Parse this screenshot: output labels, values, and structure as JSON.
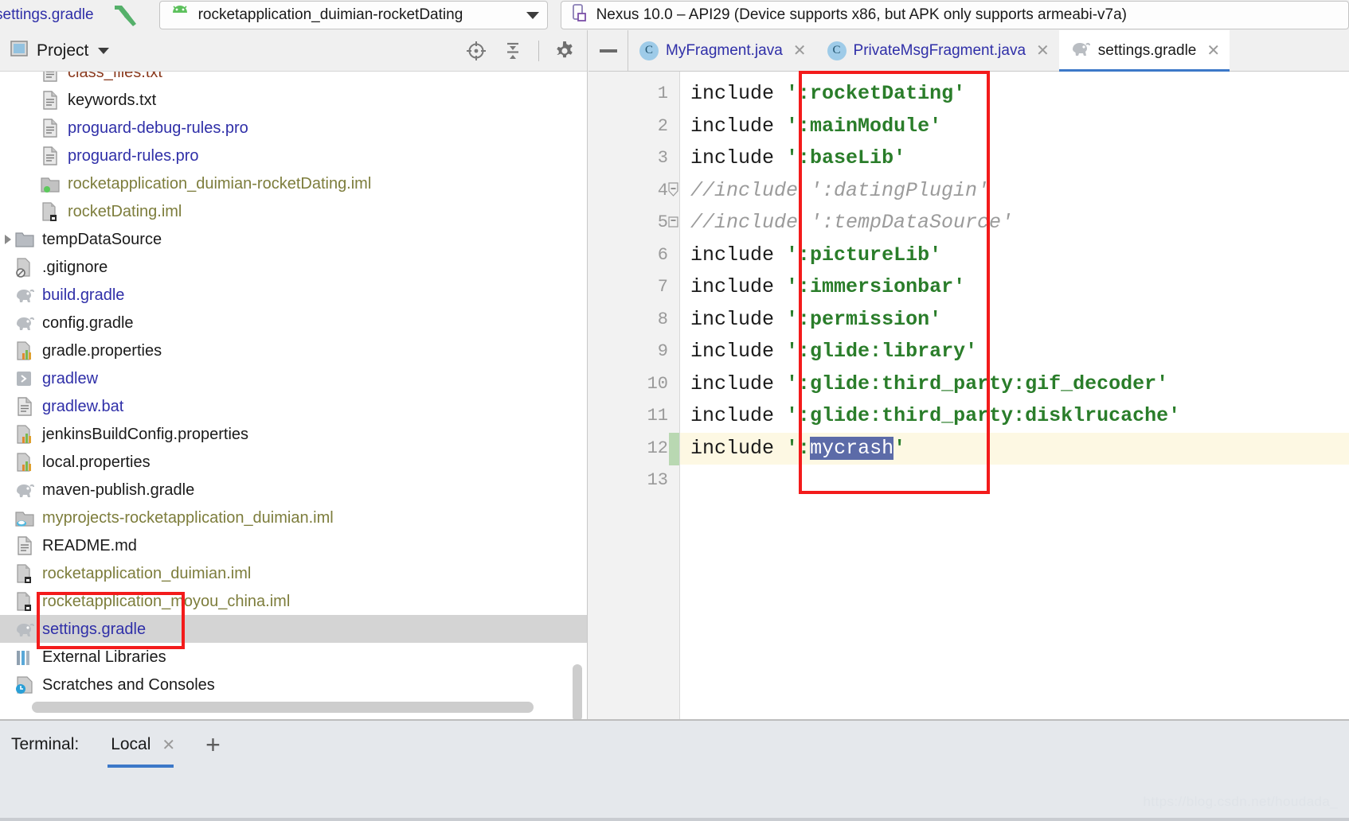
{
  "topbar": {
    "breadcrumb": "settings.gradle",
    "build_icon": "hammer-icon",
    "run_config": {
      "label": "rocketapplication_duimian-rocketDating",
      "icon": "android-robot-icon"
    },
    "device": {
      "label": "Nexus 10.0 – API29 (Device supports x86, but APK only supports armeabi-v7a)",
      "icon": "device-tablet-icon"
    }
  },
  "project_panel": {
    "title": "Project",
    "tools": [
      {
        "name": "locate-target-icon",
        "title": "Select Opened File"
      },
      {
        "name": "collapse-all-icon",
        "title": "Collapse All"
      },
      {
        "name": "gear-icon",
        "title": "Settings"
      },
      {
        "name": "minimize-icon",
        "title": "Hide"
      }
    ],
    "tree": [
      {
        "label": "class_files.txt",
        "icon": "text-file-icon",
        "color": "brown",
        "indent": 1,
        "expander": false,
        "selected": false,
        "clipped": true
      },
      {
        "label": "keywords.txt",
        "icon": "text-file-icon",
        "color": "black",
        "indent": 1,
        "expander": false,
        "selected": false
      },
      {
        "label": "proguard-debug-rules.pro",
        "icon": "text-file-icon",
        "color": "blue",
        "indent": 1,
        "expander": false,
        "selected": false
      },
      {
        "label": "proguard-rules.pro",
        "icon": "text-file-icon",
        "color": "blue",
        "indent": 1,
        "expander": false,
        "selected": false
      },
      {
        "label": "rocketapplication_duimian-rocketDating.iml",
        "icon": "module-iml-icon",
        "color": "olive",
        "indent": 1,
        "expander": false,
        "selected": false
      },
      {
        "label": "rocketDating.iml",
        "icon": "iml-file-icon",
        "color": "olive",
        "indent": 1,
        "expander": false,
        "selected": false
      },
      {
        "label": "tempDataSource",
        "icon": "folder-icon",
        "color": "black",
        "indent": 0,
        "expander": true,
        "selected": false
      },
      {
        "label": ".gitignore",
        "icon": "gitignore-file-icon",
        "color": "black",
        "indent": 0,
        "expander": false,
        "selected": false
      },
      {
        "label": "build.gradle",
        "icon": "gradle-elephant-icon",
        "color": "blue",
        "indent": 0,
        "expander": false,
        "selected": false
      },
      {
        "label": "config.gradle",
        "icon": "gradle-elephant-icon",
        "color": "black",
        "indent": 0,
        "expander": false,
        "selected": false
      },
      {
        "label": "gradle.properties",
        "icon": "properties-file-icon",
        "color": "black",
        "indent": 0,
        "expander": false,
        "selected": false
      },
      {
        "label": "gradlew",
        "icon": "shell-script-icon",
        "color": "blue",
        "indent": 0,
        "expander": false,
        "selected": false
      },
      {
        "label": "gradlew.bat",
        "icon": "text-file-icon",
        "color": "blue",
        "indent": 0,
        "expander": false,
        "selected": false
      },
      {
        "label": "jenkinsBuildConfig.properties",
        "icon": "properties-file-icon",
        "color": "black",
        "indent": 0,
        "expander": false,
        "selected": false
      },
      {
        "label": "local.properties",
        "icon": "properties-file-icon",
        "color": "black",
        "indent": 0,
        "expander": false,
        "selected": false
      },
      {
        "label": "maven-publish.gradle",
        "icon": "gradle-elephant-icon",
        "color": "black",
        "indent": 0,
        "expander": false,
        "selected": false
      },
      {
        "label": "myprojects-rocketapplication_duimian.iml",
        "icon": "java-module-iml-icon",
        "color": "olive",
        "indent": 0,
        "expander": false,
        "selected": false
      },
      {
        "label": "README.md",
        "icon": "text-file-icon",
        "color": "black",
        "indent": 0,
        "expander": false,
        "selected": false
      },
      {
        "label": "rocketapplication_duimian.iml",
        "icon": "iml-file-icon",
        "color": "olive",
        "indent": 0,
        "expander": false,
        "selected": false
      },
      {
        "label": "rocketapplication_moyou_china.iml",
        "icon": "iml-file-icon",
        "color": "olive",
        "indent": 0,
        "expander": false,
        "selected": false
      },
      {
        "label": "settings.gradle",
        "icon": "gradle-elephant-icon",
        "color": "blue",
        "indent": 0,
        "expander": false,
        "selected": true
      },
      {
        "label": "External Libraries",
        "icon": "libraries-icon",
        "color": "black",
        "indent": 0,
        "expander": false,
        "selected": false
      },
      {
        "label": "Scratches and Consoles",
        "icon": "scratches-icon",
        "color": "black",
        "indent": 0,
        "expander": false,
        "selected": false
      }
    ]
  },
  "editor": {
    "tabs": [
      {
        "label": "MyFragment.java",
        "icon": "java-class-icon",
        "active": false,
        "closable": true
      },
      {
        "label": "PrivateMsgFragment.java",
        "icon": "java-class-icon",
        "active": false,
        "closable": true
      },
      {
        "label": "settings.gradle",
        "icon": "gradle-elephant-icon",
        "active": true,
        "closable": true
      }
    ],
    "line_numbers": [
      "1",
      "2",
      "3",
      "4",
      "5",
      "6",
      "7",
      "8",
      "9",
      "10",
      "11",
      "12",
      "13"
    ],
    "lines": [
      {
        "n": 1,
        "keyword": "include ",
        "quote_open": "'",
        "module": ":rocketDating",
        "quote_close": "'",
        "comment": false,
        "highlight": false,
        "fold": false
      },
      {
        "n": 2,
        "keyword": "include ",
        "quote_open": "'",
        "module": ":mainModule",
        "quote_close": "'",
        "comment": false,
        "highlight": false,
        "fold": false
      },
      {
        "n": 3,
        "keyword": "include ",
        "quote_open": "'",
        "module": ":baseLib",
        "quote_close": "'",
        "comment": false,
        "highlight": false,
        "fold": false
      },
      {
        "n": 4,
        "comment_text": "//include ':datingPlugin'",
        "comment": true,
        "highlight": false,
        "fold": true
      },
      {
        "n": 5,
        "comment_text": "//include ':tempDataSource'",
        "comment": true,
        "highlight": false,
        "fold": true
      },
      {
        "n": 6,
        "keyword": "include ",
        "quote_open": "'",
        "module": ":pictureLib",
        "quote_close": "'",
        "comment": false,
        "highlight": false,
        "fold": false
      },
      {
        "n": 7,
        "keyword": "include ",
        "quote_open": "'",
        "module": ":immersionbar",
        "quote_close": "'",
        "comment": false,
        "highlight": false,
        "fold": false
      },
      {
        "n": 8,
        "keyword": "include ",
        "quote_open": "'",
        "module": ":permission",
        "quote_close": "'",
        "comment": false,
        "highlight": false,
        "fold": false
      },
      {
        "n": 9,
        "keyword": "include ",
        "quote_open": "'",
        "module": ":glide:library",
        "quote_close": "'",
        "comment": false,
        "highlight": false,
        "fold": false
      },
      {
        "n": 10,
        "keyword": "include ",
        "quote_open": "'",
        "module": ":glide:third_party:gif_decoder",
        "quote_close": "'",
        "comment": false,
        "highlight": false,
        "fold": false
      },
      {
        "n": 11,
        "keyword": "include ",
        "quote_open": "'",
        "module": ":glide:third_party:disklrucache",
        "quote_close": "'",
        "comment": false,
        "highlight": false,
        "fold": false
      },
      {
        "n": 12,
        "keyword": "include ",
        "quote_open": "'",
        "module_prefix": ":",
        "module_selected": "mycrash",
        "quote_close": "'",
        "comment": false,
        "highlight": true,
        "fold": false,
        "changed": true
      },
      {
        "n": 13,
        "keyword": "",
        "comment": false,
        "highlight": false,
        "fold": false
      }
    ],
    "selection_text": "mycrash"
  },
  "terminal": {
    "title": "Terminal:",
    "tab_label": "Local",
    "close_label": "✕",
    "add_label": "+"
  },
  "watermark": "https://blog.csdn.net/houdada_",
  "colors": {
    "accent_blue": "#3c78c8",
    "link_blue": "#2f2fa8",
    "string_green": "#2a7d2a",
    "annotation_red": "#f31b1b",
    "selection_blue": "#5c6ba8",
    "highlight_yellow": "#fdf8e3",
    "olive": "#7d7d3c",
    "selected_row": "#d4d4d4"
  }
}
